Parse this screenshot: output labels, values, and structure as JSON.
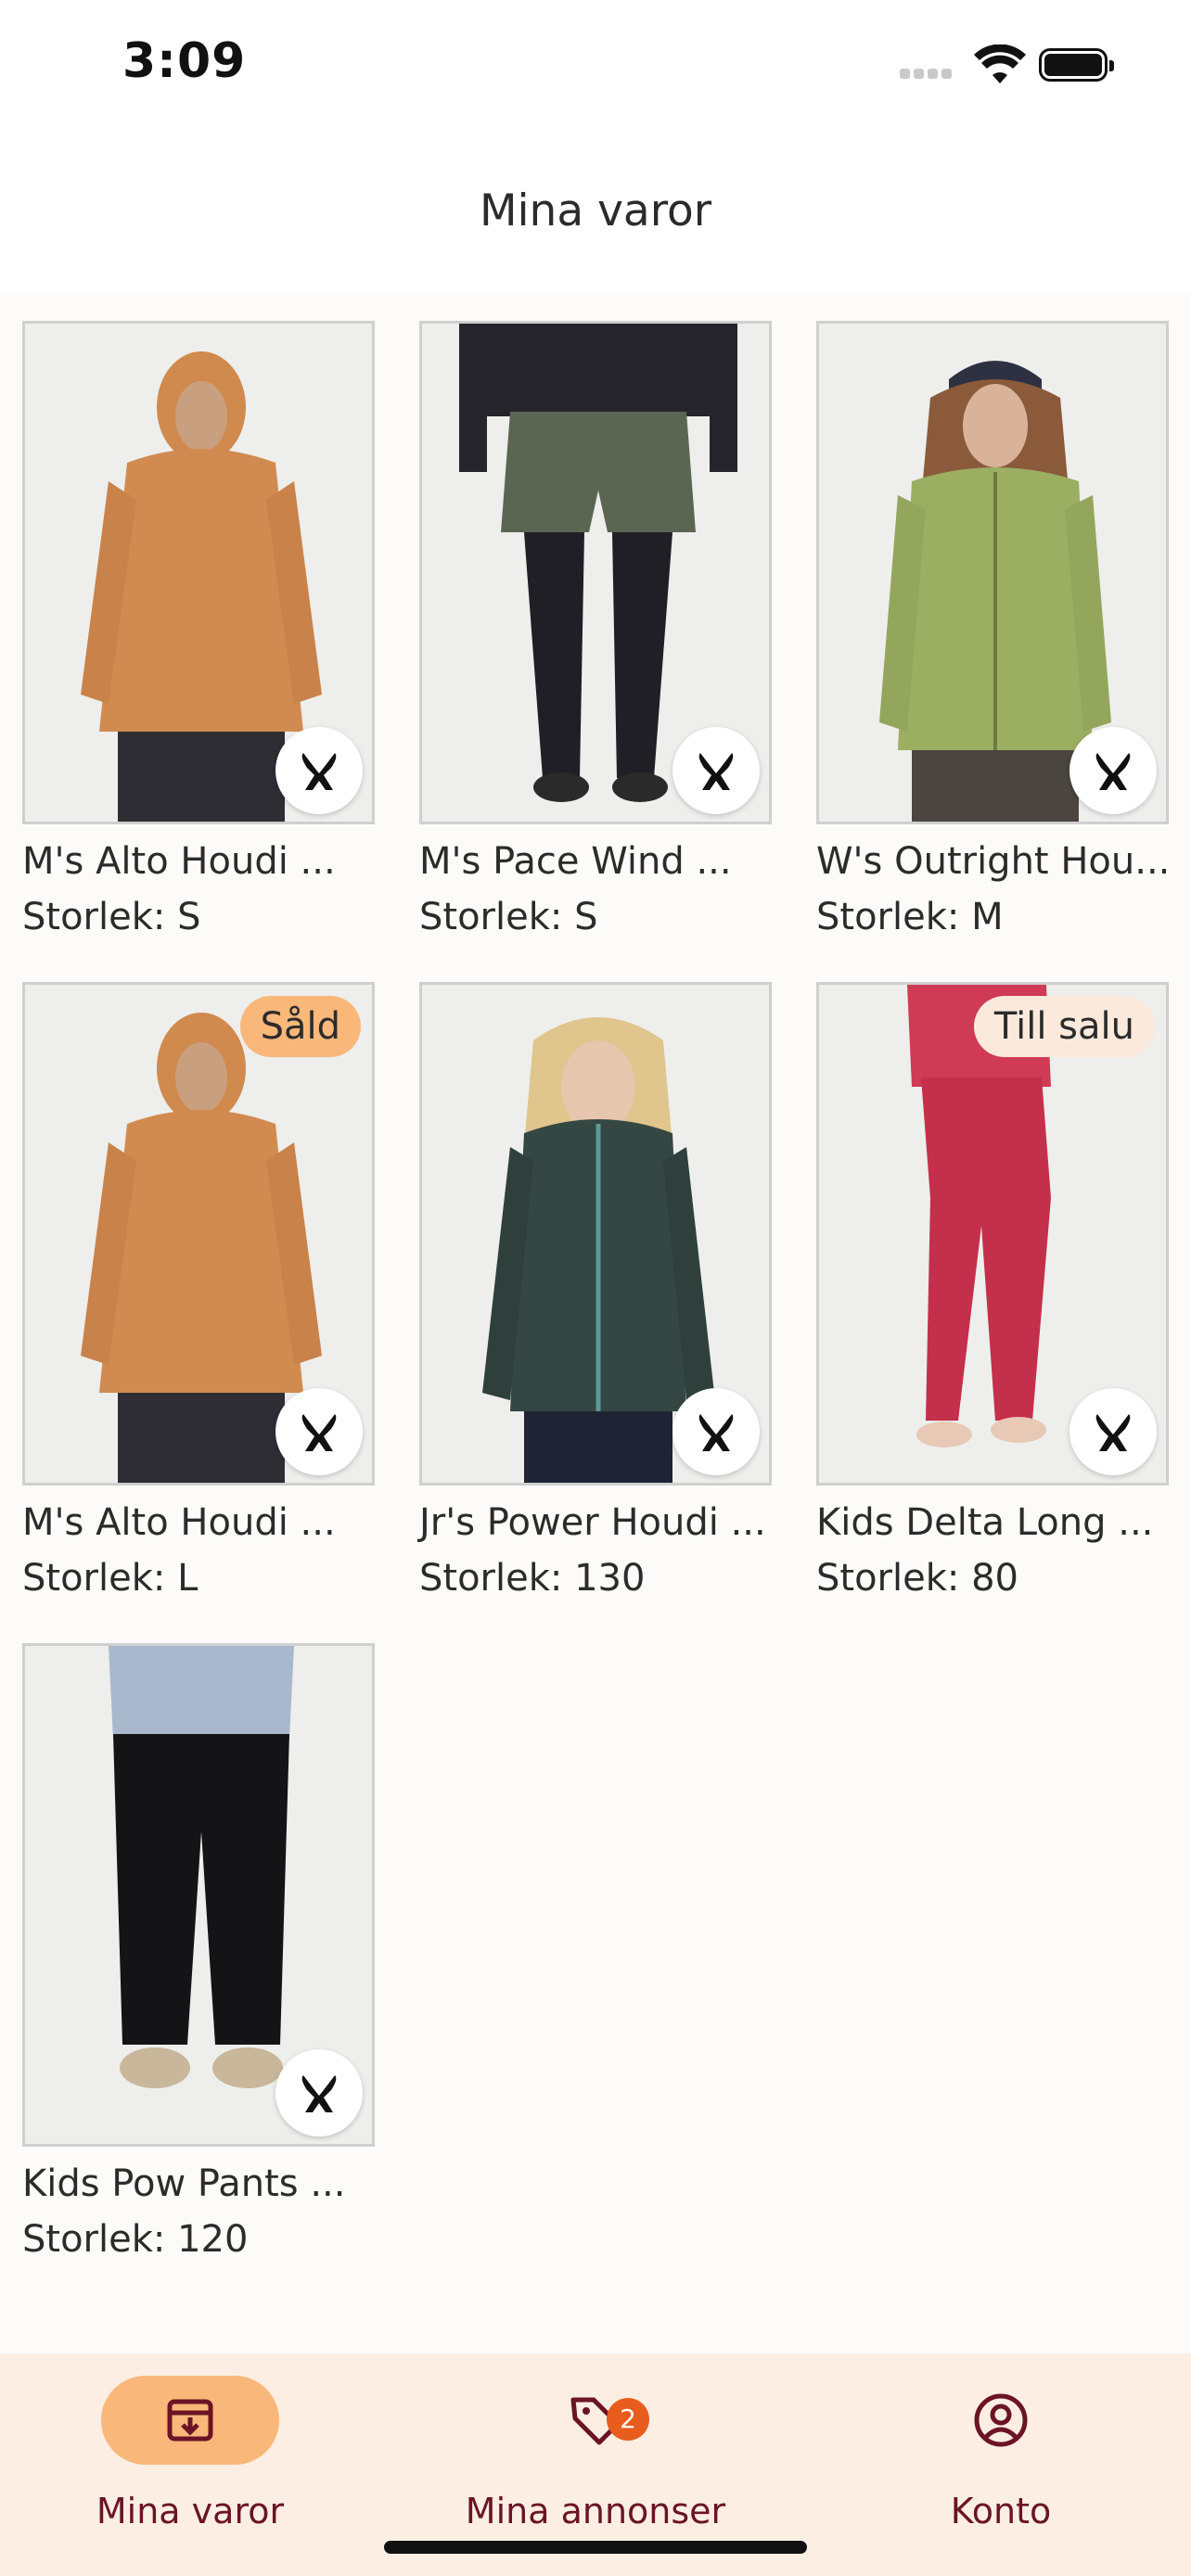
{
  "status_bar": {
    "time": "3:09"
  },
  "header": {
    "title": "Mina varor"
  },
  "products": [
    {
      "name": "M's Alto Houdi ...",
      "size": "Storlek: S",
      "status": "",
      "image": "orange-hoodie-man"
    },
    {
      "name": "M's Pace Wind ...",
      "size": "Storlek: S",
      "status": "",
      "image": "green-shorts-tights"
    },
    {
      "name": "W's Outright Hou...",
      "size": "Storlek: M",
      "status": "",
      "image": "olive-jacket-woman"
    },
    {
      "name": "M's Alto Houdi ...",
      "size": "Storlek: L",
      "status": "Såld",
      "image": "orange-hoodie-man"
    },
    {
      "name": "Jr's Power Houdi ...",
      "size": "Storlek: 130",
      "status": "",
      "image": "dark-green-jacket-kid"
    },
    {
      "name": "Kids Delta Long ...",
      "size": "Storlek: 80",
      "status": "Till salu",
      "image": "red-base-layer-kid"
    },
    {
      "name": "Kids Pow Pants ...",
      "size": "Storlek: 120",
      "status": "",
      "image": "black-pants-kid"
    }
  ],
  "tabbar": {
    "items": [
      {
        "label": "Mina varor",
        "icon": "archive-download-icon",
        "active": true
      },
      {
        "label": "Mina annonser",
        "icon": "tag-icon",
        "badge": "2"
      },
      {
        "label": "Konto",
        "icon": "user-circle-icon"
      }
    ]
  },
  "colors": {
    "accent": "#f9b77a",
    "tabbar_bg": "#fdeee3",
    "tab_text": "#6b1426",
    "badge": "#e85c1e",
    "sale_pill": "#fbe9dc"
  }
}
